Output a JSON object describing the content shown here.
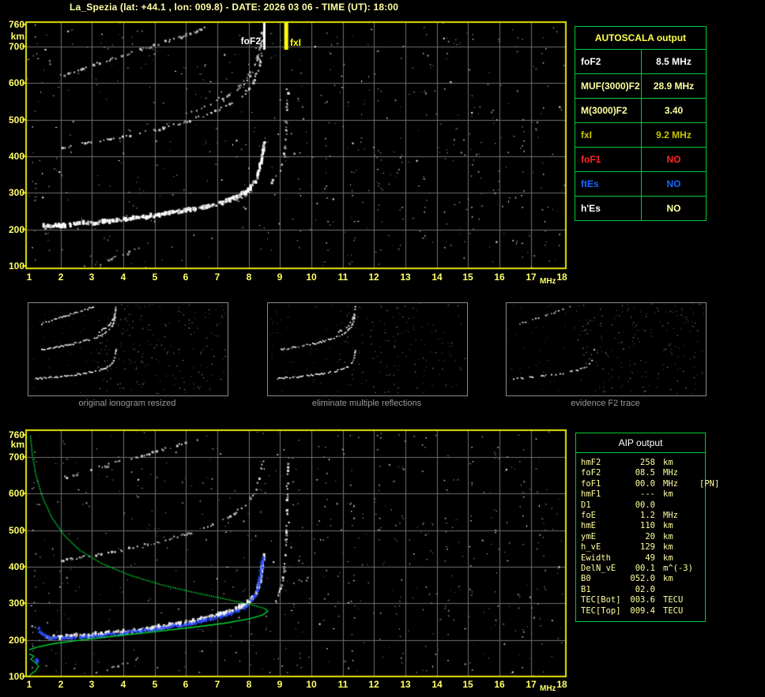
{
  "title": "La_Spezia (lat: +44.1 , lon: 009.8) - DATE: 2026 03 06 - TIME (UT): 18:00",
  "colors": {
    "background": "#000000",
    "frame_yellow": "#e6e600",
    "axis_text": "#ffff66",
    "title_text": "#ffffa6",
    "grid_gray": "#6f6f6f",
    "table_border_green": "#00cd32",
    "pale_yellow": "#ffffa0",
    "gold": "#c8c800",
    "red": "#ff2626",
    "blue": "#1a66ff",
    "white": "#ffffff",
    "caption_gray": "#9a9a9a",
    "profile_green": "#00dd33",
    "trace_blue": "#2a4bff"
  },
  "autoscala_table": {
    "header": "AUTOSCALA output",
    "rows": [
      {
        "label": "foF2",
        "value": "8.5 MHz",
        "label_color": "#ffffff",
        "value_color": "#ffffff"
      },
      {
        "label": "MUF(3000)F2",
        "value": "28.9 MHz",
        "label_color": "#ffffa0",
        "value_color": "#ffffa0"
      },
      {
        "label": "M(3000)F2",
        "value": "3.40",
        "label_color": "#ffffa0",
        "value_color": "#ffffa0"
      },
      {
        "label": "fxI",
        "value": "9.2 MHz",
        "label_color": "#c8c800",
        "value_color": "#c8c800"
      },
      {
        "label": "foF1",
        "value": "NO",
        "label_color": "#ff2626",
        "value_color": "#ff2626"
      },
      {
        "label": "ftEs",
        "value": "NO",
        "label_color": "#1a66ff",
        "value_color": "#1a66ff"
      },
      {
        "label": "h'Es",
        "value": "NO",
        "label_color": "#ffffff",
        "value_color": "#ffffa0"
      }
    ]
  },
  "aip_table": {
    "header": "AIP output",
    "rows": [
      {
        "name": "hmF2",
        "value": "258",
        "unit": "km",
        "note": ""
      },
      {
        "name": "foF2",
        "value": "08.5",
        "unit": "MHz",
        "note": ""
      },
      {
        "name": "foF1",
        "value": "00.0",
        "unit": "MHz",
        "note": "[PN]"
      },
      {
        "name": "hmF1",
        "value": "---",
        "unit": "km",
        "note": ""
      },
      {
        "name": "D1",
        "value": "00.0",
        "unit": "",
        "note": ""
      },
      {
        "name": "foE",
        "value": "1.2",
        "unit": "MHz",
        "note": ""
      },
      {
        "name": "hmE",
        "value": "110",
        "unit": "km",
        "note": ""
      },
      {
        "name": "ymE",
        "value": "20",
        "unit": "km",
        "note": ""
      },
      {
        "name": "h_vE",
        "value": "129",
        "unit": "km",
        "note": ""
      },
      {
        "name": "Ewidth",
        "value": "49",
        "unit": "km",
        "note": ""
      },
      {
        "name": "DelN_vE",
        "value": "00.1",
        "unit": "m^(-3)",
        "note": ""
      },
      {
        "name": "B0",
        "value": "052.0",
        "unit": "km",
        "note": ""
      },
      {
        "name": "B1",
        "value": "02.0",
        "unit": "",
        "note": ""
      },
      {
        "name": "TEC[Bot]",
        "value": "003.6",
        "unit": "TECU",
        "note": ""
      },
      {
        "name": "TEC[Top]",
        "value": "009.4",
        "unit": "TECU",
        "note": ""
      }
    ]
  },
  "thumbnails": [
    {
      "caption": "original ionogram resized"
    },
    {
      "caption": "eliminate multiple reflections"
    },
    {
      "caption": "evidence F2 trace"
    }
  ],
  "chart_data": [
    {
      "id": "top_ionogram",
      "type": "scatter",
      "title": "recorded ionogram with autoscaled characteristics",
      "xlabel": "MHz",
      "ylabel": "km",
      "xlim": [
        1,
        18
      ],
      "ylim": [
        100,
        760
      ],
      "xticks": [
        1,
        2,
        3,
        4,
        5,
        6,
        7,
        8,
        9,
        10,
        11,
        12,
        13,
        14,
        15,
        16,
        17,
        18
      ],
      "yticks": [
        760,
        700,
        600,
        500,
        400,
        300,
        200,
        100
      ],
      "grid": true,
      "markers": [
        {
          "label": "foF2",
          "freq_mhz": 8.5,
          "color": "#ffffff"
        },
        {
          "label": "fxI",
          "freq_mhz": 9.2,
          "color": "#ffff00"
        }
      ],
      "traces": [
        {
          "name": "F2-O-first-echo",
          "color": "#ffffff",
          "style": "band",
          "size": 3,
          "density": 0.92,
          "points": [
            [
              1.45,
              208
            ],
            [
              2,
              211
            ],
            [
              3,
              218
            ],
            [
              4,
              227
            ],
            [
              5,
              238
            ],
            [
              6,
              252
            ],
            [
              6.8,
              266
            ],
            [
              7.4,
              281
            ],
            [
              7.9,
              302
            ],
            [
              8.2,
              330
            ],
            [
              8.35,
              368
            ],
            [
              8.45,
              415
            ],
            [
              8.5,
              445
            ]
          ]
        },
        {
          "name": "F2-X-first-echo",
          "color": "#e8e8e8",
          "style": "dots",
          "size": 2,
          "density": 0.5,
          "points": [
            [
              6.6,
              262
            ],
            [
              7.2,
              275
            ],
            [
              7.8,
              291
            ],
            [
              8.3,
              310
            ],
            [
              8.7,
              333
            ],
            [
              9.0,
              368
            ],
            [
              9.1,
              405
            ],
            [
              9.17,
              460
            ],
            [
              9.2,
              540
            ],
            [
              9.22,
              600
            ]
          ]
        },
        {
          "name": "F2-O-second-echo",
          "color": "#d2d2d2",
          "style": "dots",
          "size": 2,
          "density": 0.5,
          "points": [
            [
              2.0,
              425
            ],
            [
              3,
              441
            ],
            [
              4,
              456
            ],
            [
              5,
              474
            ],
            [
              6,
              497
            ],
            [
              6.7,
              517
            ],
            [
              7.3,
              540
            ],
            [
              7.8,
              568
            ],
            [
              8.1,
              598
            ],
            [
              8.3,
              640
            ],
            [
              8.4,
              688
            ]
          ]
        },
        {
          "name": "F2-X-second-echo",
          "color": "#c0c0c0",
          "style": "dots",
          "size": 2,
          "density": 0.38,
          "points": [
            [
              6.0,
              520
            ],
            [
              6.8,
              545
            ],
            [
              7.4,
              572
            ],
            [
              7.9,
              605
            ],
            [
              8.2,
              650
            ],
            [
              8.35,
              705
            ],
            [
              8.4,
              750
            ]
          ]
        },
        {
          "name": "F2-third-echo",
          "color": "#cccccc",
          "style": "dots",
          "size": 2,
          "density": 0.45,
          "points": [
            [
              2.0,
              622
            ],
            [
              3,
              650
            ],
            [
              4,
              678
            ],
            [
              5,
              706
            ],
            [
              6,
              734
            ],
            [
              6.6,
              753
            ]
          ]
        },
        {
          "name": "F2-third-echo-asymptote",
          "color": "#bbbbbb",
          "style": "dots",
          "size": 2,
          "density": 0.32,
          "points": [
            [
              7.0,
              560
            ],
            [
              7.8,
              602
            ],
            [
              8.2,
              652
            ],
            [
              8.4,
              704
            ],
            [
              8.45,
              756
            ]
          ]
        },
        {
          "name": "low-streak",
          "color": "#9a9a9a",
          "style": "dots",
          "size": 2,
          "density": 0.3,
          "points": [
            [
              3.3,
              112
            ],
            [
              4.0,
              135
            ],
            [
              4.8,
              160
            ]
          ]
        }
      ]
    },
    {
      "id": "bottom_ionogram",
      "type": "scatter",
      "title": "ionogram with restored trace and electron density profile",
      "xlabel": "MHz",
      "ylabel": "km",
      "xlim": [
        1,
        18
      ],
      "ylim": [
        100,
        760
      ],
      "xticks": [
        1,
        2,
        3,
        4,
        5,
        6,
        7,
        8,
        9,
        10,
        11,
        12,
        13,
        14,
        15,
        16,
        17,
        18
      ],
      "yticks": [
        760,
        700,
        600,
        500,
        400,
        300,
        200,
        100
      ],
      "grid": true,
      "markers": [],
      "traces": [
        {
          "name": "F2-O-first-echo",
          "color": "#f2f2f2",
          "style": "band",
          "size": 3,
          "density": 0.85,
          "points": [
            [
              1.5,
              205
            ],
            [
              2,
              208
            ],
            [
              3,
              214
            ],
            [
              4,
              222
            ],
            [
              5,
              233
            ],
            [
              6,
              247
            ],
            [
              6.8,
              262
            ],
            [
              7.4,
              277
            ],
            [
              7.9,
              297
            ],
            [
              8.2,
              322
            ],
            [
              8.35,
              358
            ],
            [
              8.45,
              408
            ],
            [
              8.5,
              438
            ]
          ]
        },
        {
          "name": "F2-X-first-echo",
          "color": "#e8e8e8",
          "style": "dots",
          "size": 2,
          "density": 0.5,
          "points": [
            [
              8.85,
              305
            ],
            [
              9.0,
              340
            ],
            [
              9.1,
              385
            ],
            [
              9.17,
              455
            ],
            [
              9.2,
              560
            ],
            [
              9.23,
              700
            ]
          ]
        },
        {
          "name": "F2-O-second-echo",
          "color": "#cfcfcf",
          "style": "dots",
          "size": 2,
          "density": 0.42,
          "points": [
            [
              2.0,
              418
            ],
            [
              3,
              432
            ],
            [
              4,
              448
            ],
            [
              5,
              468
            ],
            [
              6,
              492
            ],
            [
              6.8,
              515
            ],
            [
              7.4,
              540
            ],
            [
              7.9,
              572
            ],
            [
              8.2,
              610
            ],
            [
              8.35,
              655
            ],
            [
              8.45,
              700
            ]
          ]
        },
        {
          "name": "F2-third-echo",
          "color": "#c8c8c8",
          "style": "dots",
          "size": 2,
          "density": 0.4,
          "points": [
            [
              2.0,
              644
            ],
            [
              3,
              668
            ],
            [
              4,
              692
            ],
            [
              5,
              716
            ],
            [
              6,
              740
            ],
            [
              6.5,
              753
            ]
          ]
        },
        {
          "name": "low-streak",
          "color": "#9a9a9a",
          "style": "dots",
          "size": 2,
          "density": 0.3,
          "points": [
            [
              3.1,
              110
            ],
            [
              3.8,
              132
            ],
            [
              4.5,
              152
            ]
          ]
        },
        {
          "name": "autoscala-restored-trace",
          "color": "#2a4bff",
          "style": "plus",
          "size": 2,
          "density": 0.95,
          "points": [
            [
              1.3,
              230
            ],
            [
              1.4,
              215
            ],
            [
              1.6,
              207
            ],
            [
              2.2,
              206
            ],
            [
              3,
              211
            ],
            [
              4,
              219
            ],
            [
              5,
              230
            ],
            [
              6,
              244
            ],
            [
              6.8,
              258
            ],
            [
              7.4,
              272
            ],
            [
              7.9,
              292
            ],
            [
              8.15,
              315
            ],
            [
              8.3,
              348
            ],
            [
              8.4,
              395
            ],
            [
              8.45,
              432
            ]
          ]
        },
        {
          "name": "blue-low-marks",
          "color": "#2a4bff",
          "style": "plus",
          "size": 2,
          "density": 1,
          "points": [
            [
              1.22,
              150
            ],
            [
              1.25,
              136
            ]
          ]
        },
        {
          "name": "electron-density-profile-top",
          "color": "#00dd33",
          "style": "dotline",
          "size": 1.6,
          "density": 1,
          "points": [
            [
              1.02,
              758
            ],
            [
              1.08,
              706
            ],
            [
              1.2,
              650
            ],
            [
              1.4,
              592
            ],
            [
              1.7,
              536
            ],
            [
              2.1,
              487
            ],
            [
              2.6,
              446
            ],
            [
              3.3,
              410
            ],
            [
              4.2,
              378
            ],
            [
              5.2,
              352
            ],
            [
              6.3,
              330
            ],
            [
              7.3,
              312
            ],
            [
              8.1,
              297
            ],
            [
              8.5,
              287
            ],
            [
              8.62,
              279
            ]
          ]
        },
        {
          "name": "electron-density-profile-bottom",
          "color": "#00dd33",
          "style": "line",
          "size": 1.4,
          "density": 1,
          "points": [
            [
              8.62,
              279
            ],
            [
              8.45,
              268
            ],
            [
              8.0,
              257
            ],
            [
              7.2,
              245
            ],
            [
              6.2,
              234
            ],
            [
              5.0,
              222
            ],
            [
              3.8,
              211
            ],
            [
              2.7,
              200
            ],
            [
              1.8,
              190
            ],
            [
              1.25,
              180
            ],
            [
              1.0,
              173
            ]
          ]
        },
        {
          "name": "electron-density-profile-E-layer",
          "color": "#00dd33",
          "style": "line",
          "size": 1.2,
          "density": 1,
          "points": [
            [
              1.0,
              162
            ],
            [
              1.15,
              155
            ],
            [
              1.05,
              147
            ],
            [
              1.18,
              139
            ],
            [
              1.3,
              128
            ],
            [
              1.2,
              115
            ],
            [
              1.05,
              106
            ],
            [
              1.0,
              102
            ]
          ]
        }
      ]
    }
  ]
}
